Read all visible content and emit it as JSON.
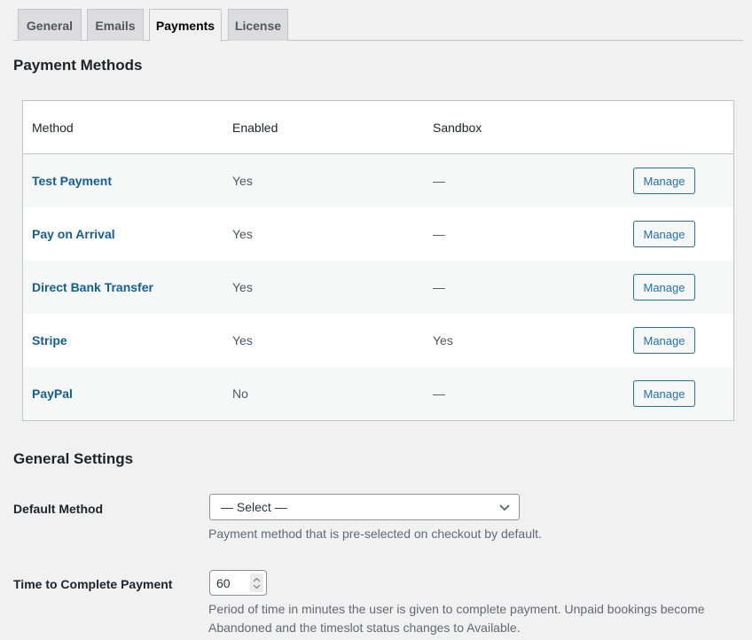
{
  "tabs": [
    {
      "label": "General",
      "active": false
    },
    {
      "label": "Emails",
      "active": false
    },
    {
      "label": "Payments",
      "active": true
    },
    {
      "label": "License",
      "active": false
    }
  ],
  "payment_methods": {
    "title": "Payment Methods",
    "columns": [
      "Method",
      "Enabled",
      "Sandbox"
    ],
    "rows": [
      {
        "method": "Test Payment",
        "enabled": "Yes",
        "sandbox": "—",
        "action": "Manage"
      },
      {
        "method": "Pay on Arrival",
        "enabled": "Yes",
        "sandbox": "—",
        "action": "Manage"
      },
      {
        "method": "Direct Bank Transfer",
        "enabled": "Yes",
        "sandbox": "—",
        "action": "Manage"
      },
      {
        "method": "Stripe",
        "enabled": "Yes",
        "sandbox": "Yes",
        "action": "Manage"
      },
      {
        "method": "PayPal",
        "enabled": "No",
        "sandbox": "—",
        "action": "Manage"
      }
    ]
  },
  "general_settings": {
    "title": "General Settings",
    "default_method": {
      "label": "Default Method",
      "selected": "— Select —",
      "description": "Payment method that is pre-selected on checkout by default."
    },
    "time_to_complete": {
      "label": "Time to Complete Payment",
      "value": "60",
      "description": "Period of time in minutes the user is given to complete payment. Unpaid bookings become Abandoned and the timeslot status changes to Available."
    }
  },
  "colors": {
    "link": "#135e96",
    "button_border": "#2271b1",
    "background": "#f1f1f1"
  }
}
